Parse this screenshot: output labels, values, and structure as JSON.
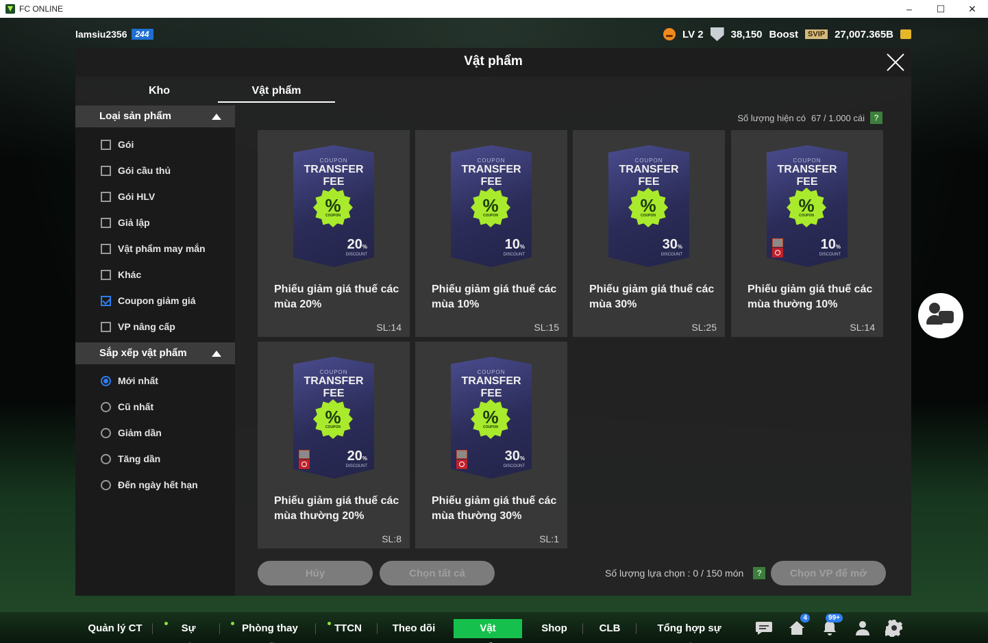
{
  "window": {
    "title": "FC ONLINE",
    "minimize": "–",
    "maximize": "☐",
    "close": "✕"
  },
  "hud": {
    "username": "lamsiu2356",
    "level": "244",
    "lv": "LV 2",
    "points": "38,150",
    "boost": "Boost",
    "svip": "SVIP",
    "coins": "27,007.365B"
  },
  "modal": {
    "title": "Vật phẩm",
    "tabs": [
      "Kho",
      "Vật phẩm"
    ],
    "count_label": "Số lượng hiện có",
    "count_value": "67 / 1.000 cái",
    "help": "?"
  },
  "sidebar": {
    "product_type_title": "Loại sản phẩm",
    "product_types": [
      {
        "label": "Gói",
        "checked": false
      },
      {
        "label": "Gói cầu thủ",
        "checked": false
      },
      {
        "label": "Gói HLV",
        "checked": false
      },
      {
        "label": "Giả lập",
        "checked": false
      },
      {
        "label": "Vật phẩm may mắn",
        "checked": false
      },
      {
        "label": "Khác",
        "checked": false
      },
      {
        "label": "Coupon giảm giá",
        "checked": true
      },
      {
        "label": "VP nâng cấp",
        "checked": false
      }
    ],
    "sort_title": "Sắp xếp vật phẩm",
    "sort_options": [
      {
        "label": "Mới nhất",
        "checked": true
      },
      {
        "label": "Cũ nhất",
        "checked": false
      },
      {
        "label": "Giảm dần",
        "checked": false
      },
      {
        "label": "Tăng dần",
        "checked": false
      },
      {
        "label": "Đến ngày hết hạn",
        "checked": false
      }
    ]
  },
  "cards": [
    {
      "coupon_small": "COUPON",
      "coupon_title": "TRANSFER FEE",
      "badge": "%",
      "badge_sub": "COUPON",
      "value": "20",
      "unit": "%",
      "discount": "DISCOUNT",
      "name": "Phiếu giảm giá thuế các mùa 20%",
      "qty": "SL:14",
      "locked": false
    },
    {
      "coupon_small": "COUPON",
      "coupon_title": "TRANSFER FEE",
      "badge": "%",
      "badge_sub": "COUPON",
      "value": "10",
      "unit": "%",
      "discount": "DISCOUNT",
      "name": "Phiếu giảm giá thuế các mùa 10%",
      "qty": "SL:15",
      "locked": false
    },
    {
      "coupon_small": "COUPON",
      "coupon_title": "TRANSFER FEE",
      "badge": "%",
      "badge_sub": "COUPON",
      "value": "30",
      "unit": "%",
      "discount": "DISCOUNT",
      "name": "Phiếu giảm giá thuế các mùa 30%",
      "qty": "SL:25",
      "locked": false
    },
    {
      "coupon_small": "COUPON",
      "coupon_title": "TRANSFER FEE",
      "badge": "%",
      "badge_sub": "COUPON",
      "value": "10",
      "unit": "%",
      "discount": "DISCOUNT",
      "name": "Phiếu giảm giá thuế các mùa thường 10%",
      "qty": "SL:14",
      "locked": true
    },
    {
      "coupon_small": "COUPON",
      "coupon_title": "TRANSFER FEE",
      "badge": "%",
      "badge_sub": "COUPON",
      "value": "20",
      "unit": "%",
      "discount": "DISCOUNT",
      "name": "Phiếu giảm giá thuế các mùa thường 20%",
      "qty": "SL:8",
      "locked": true
    },
    {
      "coupon_small": "COUPON",
      "coupon_title": "TRANSFER FEE",
      "badge": "%",
      "badge_sub": "COUPON",
      "value": "30",
      "unit": "%",
      "discount": "DISCOUNT",
      "name": "Phiếu giảm giá thuế các mùa thường 30%",
      "qty": "SL:1",
      "locked": true
    }
  ],
  "actions": {
    "cancel": "Hủy",
    "select_all": "Chọn tất cả",
    "selected_label": "Số lượng lựa chọn : 0 / 150 món",
    "help": "?",
    "open_selected": "Chọn VP để mở"
  },
  "nav": {
    "items": [
      "Quản lý CT",
      "Sự kiện",
      "Phòng thay đồ",
      "TTCN",
      "Theo dõi",
      "Vật phẩm",
      "Shop",
      "CLB",
      "Tổng hợp sự kiện"
    ],
    "active": "Vật phẩm",
    "home_badge": "4",
    "bell_badge": "99+"
  },
  "colors": {
    "accent_green": "#16c04c",
    "badge_green": "#a9ea2c",
    "checkbox_blue": "#2e7ef0",
    "level_blue": "#1e6fd1"
  }
}
